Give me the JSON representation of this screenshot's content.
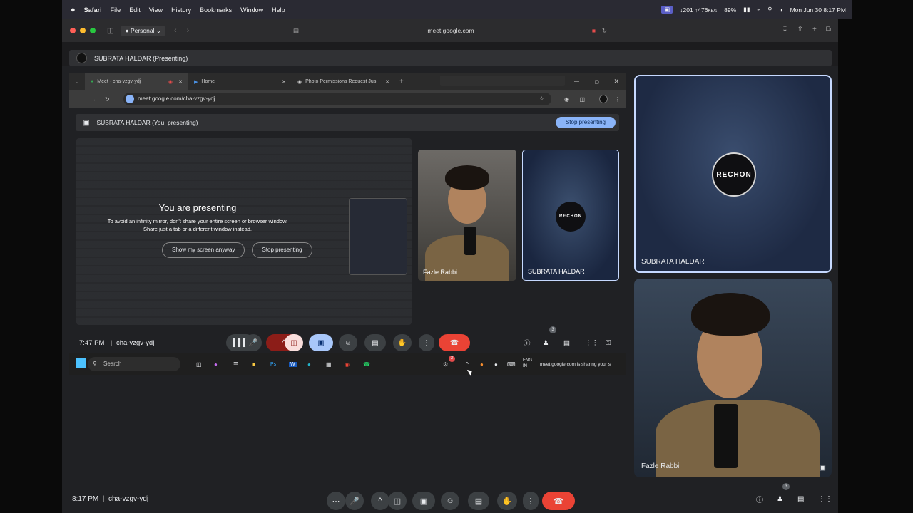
{
  "mac_menubar": {
    "apple": "",
    "app": "Safari",
    "items": [
      "File",
      "Edit",
      "View",
      "History",
      "Bookmarks",
      "Window",
      "Help"
    ],
    "net": "↓201 ↑476",
    "net_unit": "KB/s",
    "battery": "89%",
    "datetime": "Mon Jun 30  8:17 PM"
  },
  "safari": {
    "profile": "Personal",
    "url": "meet.google.com"
  },
  "presenting_bar": {
    "label": "SUBRATA HALDAR (Presenting)"
  },
  "shared_screen": {
    "tabs": [
      {
        "label": "Meet - cha-vzgv-ydj"
      },
      {
        "label": "Home"
      },
      {
        "label": "Photo Permissions Request Jus"
      }
    ],
    "url": "meet.google.com/cha-vzgv-ydj",
    "present_bar": {
      "label": "SUBRATA HALDAR (You, presenting)",
      "stop": "Stop presenting"
    },
    "mirror": {
      "title": "You are presenting",
      "text1": "To avoid an infinity mirror, don't share your entire screen or browser window.",
      "text2": "Share just a tab or a different window instead.",
      "show_btn": "Show my screen anyway",
      "stop_btn": "Stop presenting"
    },
    "tiles": [
      {
        "name": "Fazle Rabbi"
      },
      {
        "name": "SUBRATA HALDAR",
        "logo": "RECHON"
      }
    ],
    "bottom": {
      "time": "7:47 PM",
      "code": "cha-vzgv-ydj",
      "people_badge": "3"
    },
    "taskbar": {
      "search": "Search",
      "lang1": "ENG",
      "lang2": "IN",
      "notification_badge": "2",
      "sharing_text": "meet.google.com is sharing your s"
    }
  },
  "right_tiles": [
    {
      "name": "SUBRATA HALDAR",
      "logo": "RECHON"
    },
    {
      "name": "Fazle Rabbi"
    }
  ],
  "bottombar": {
    "time": "8:17 PM",
    "code": "cha-vzgv-ydj",
    "people_badge": "3"
  },
  "colors": {
    "accent": "#8ab4f8",
    "end_call": "#ea4335",
    "meet_bg": "#202124"
  }
}
